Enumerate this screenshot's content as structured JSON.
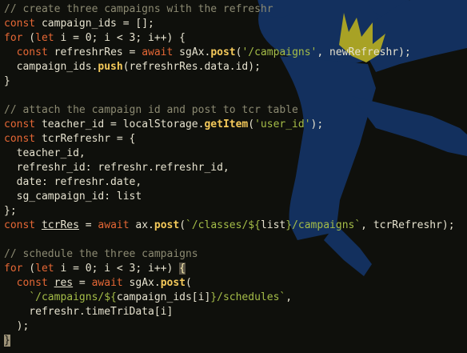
{
  "colors": {
    "background": "#0f100c",
    "text": "#e6e2cf",
    "comment": "#8c8a72",
    "keyword": "#e56735",
    "function": "#f4c95a",
    "string": "#a5bd48",
    "wallpaper_bear": "#13305e",
    "wallpaper_collar": "#a8a225"
  },
  "wallpaper": {
    "icon": "dancing-bear-icon"
  },
  "code": {
    "l1": {
      "comment": "// create three campaigns with the refreshr"
    },
    "l2": {
      "kw": "const",
      "rest": " campaign_ids = [];"
    },
    "l3": {
      "kw1": "for",
      "a": " (",
      "kw2": "let",
      "b": " i = 0; i < 3; i++) {"
    },
    "l4": {
      "indent": "  ",
      "kw1": "const",
      "a": " refreshrRes = ",
      "kw2": "await",
      "b": " sgAx.",
      "fn": "post",
      "c": "(",
      "str": "'/campaigns'",
      "d": ", newRefreshr);"
    },
    "l5": {
      "a": "  campaign_ids.",
      "fn": "push",
      "b": "(refreshrRes.data.id);"
    },
    "l6": {
      "text": "}"
    },
    "l7": {
      "text": ""
    },
    "l8": {
      "comment": "// attach the campaign id and post to tcr table"
    },
    "l9": {
      "kw": "const",
      "a": " teacher_id = localStorage.",
      "fn": "getItem",
      "b": "(",
      "str": "'user_id'",
      "c": ");"
    },
    "l10": {
      "kw": "const",
      "a": " tcrRefreshr = {"
    },
    "l11": {
      "text": "  teacher_id,"
    },
    "l12": {
      "text": "  refreshr_id: refreshr.refreshr_id,"
    },
    "l13": {
      "text": "  date: refreshr.date,"
    },
    "l14": {
      "text": "  sg_campaign_id: list"
    },
    "l15": {
      "text": "};"
    },
    "l16": {
      "kw1": "const",
      "sp": " ",
      "ul": "tcrRes",
      "a": " = ",
      "kw2": "await",
      "b": " ax.",
      "fn": "post",
      "c": "(",
      "str1": "`/classes/${",
      "d": "list",
      "str2": "}/campaigns`",
      "e": ", tcrRefreshr);"
    },
    "l17": {
      "text": ""
    },
    "l18": {
      "comment": "// schedule the three campaigns"
    },
    "l19": {
      "kw1": "for",
      "a": " (",
      "kw2": "let",
      "b": " i = 0; i < 3; i++) ",
      "bracket": "{"
    },
    "l20": {
      "indent": "  ",
      "kw1": "const",
      "sp": " ",
      "ul": "res",
      "a": " = ",
      "kw2": "await",
      "b": " sgAx.",
      "fn": "post",
      "c": "("
    },
    "l21": {
      "indent": "    ",
      "str1": "`/campaigns/${",
      "a": "campaign_ids[i]",
      "str2": "}/schedules`",
      "b": ","
    },
    "l22": {
      "text": "    refreshr.timeTriData[i]"
    },
    "l23": {
      "text": "  );"
    },
    "l24": {
      "cursor": "}"
    }
  }
}
